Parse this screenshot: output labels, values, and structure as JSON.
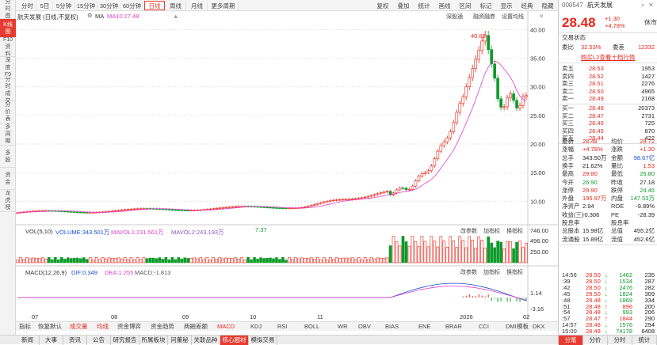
{
  "sidebar": {
    "tabs": [
      {
        "label": "分时图",
        "active": false
      },
      {
        "label": "K线图",
        "active": true
      },
      {
        "label": "F10资料",
        "active": false
      },
      {
        "label": "深度F9",
        "active": false
      },
      {
        "label": "分时成交",
        "active": false
      },
      {
        "label": "分价表",
        "active": false
      },
      {
        "label": "多周期",
        "active": false
      },
      {
        "label": "多股",
        "active": false
      },
      {
        "label": "资金",
        "active": false
      },
      {
        "label": "龙虎榜",
        "active": false
      }
    ]
  },
  "toolbar": {
    "period_tabs": [
      "分时",
      "5日",
      "5分钟",
      "15分钟",
      "30分钟",
      "60分钟",
      "日线",
      "周线",
      "月线",
      "更多周期"
    ],
    "active_period": "日线",
    "right_buttons": [
      "复权",
      "叠加",
      "统计",
      "画线",
      "区间",
      "标记",
      "显示",
      "经典",
      "隐藏"
    ]
  },
  "chart": {
    "stock_title": "航天发展",
    "adjust_note": "(日线,不复权)",
    "ma_label": "MA",
    "ma_value": "MA10:27.48",
    "panel_buttons": [
      "深股通",
      "融资融券",
      "设置均线"
    ],
    "y_ticks": [
      "40.00",
      "35.00",
      "30.00",
      "25.00",
      "20.00",
      "15.00",
      "10.00"
    ],
    "high_annotation": "40.65",
    "low_annotation": "7.37",
    "vol_label": "VOL(5,10)",
    "vol_value": "VOLUME:343.501万",
    "vol_ma5": "MAVOL1:231.561万",
    "vol_ma10": "MAVOL2:243.193万",
    "vol_ticks": [
      "746.00",
      "496.00",
      "250.00"
    ],
    "subpanel_buttons": [
      "改参数",
      "加指标",
      "换指标"
    ],
    "macd_label": "MACD(12,26,9)",
    "macd_dif": "DIF:0.349",
    "macd_dea": "DEA:1.255",
    "macd_val": "MACD:-1.813",
    "macd_ticks": [
      "1.14",
      "-3.16"
    ],
    "x_labels": [
      "07",
      "08",
      "09",
      "10",
      "11",
      "2026",
      "02"
    ]
  },
  "indicator_bar": {
    "items": [
      "指标",
      "恢复默认",
      "成交量",
      "均线",
      "资金博弈",
      "资金趋势",
      "两融差额",
      "MACD",
      "KDJ",
      "RSI",
      "BOLL",
      "WR",
      "OBV",
      "BIAS",
      "ENE",
      "BRAR",
      "CCI",
      "DMI",
      "DKX",
      "CR",
      "PSY",
      "KD",
      "更多"
    ],
    "right": "模板"
  },
  "bottom_tabs": {
    "items": [
      "新闻",
      "大事",
      "资讯",
      "公告",
      "研究报告",
      "所属板块",
      "问董秘",
      "关联品种",
      "核心题材",
      "模拟交易"
    ],
    "active": "核心题材"
  },
  "quote": {
    "code": "000547",
    "name": "航天发展",
    "list_label": "休市",
    "price": "28.48",
    "change": "+1.30",
    "change_pct": "+4.78%",
    "status_label": "交易状态",
    "weibi_label": "委比",
    "weibi": "32.53%",
    "weicha_label": "委差",
    "weicha": "12332",
    "l2_link": "购买L2查看十档行情",
    "asks": [
      {
        "label": "卖五",
        "price": "28.53",
        "vol": "1953"
      },
      {
        "label": "卖四",
        "price": "28.52",
        "vol": "1427"
      },
      {
        "label": "卖三",
        "price": "28.51",
        "vol": "2276"
      },
      {
        "label": "卖二",
        "price": "28.50",
        "vol": "4965"
      },
      {
        "label": "卖一",
        "price": "28.49",
        "vol": "2168"
      }
    ],
    "bids": [
      {
        "label": "买一",
        "price": "28.48",
        "vol": "20373"
      },
      {
        "label": "买二",
        "price": "28.47",
        "vol": "2731"
      },
      {
        "label": "买三",
        "price": "28.46",
        "vol": "725"
      },
      {
        "label": "买四",
        "price": "28.45",
        "vol": "870"
      },
      {
        "label": "买五",
        "price": "28.44",
        "vol": "422"
      }
    ],
    "stats": [
      {
        "k1": "最新",
        "v1": "28.48",
        "c1": "red",
        "k2": "均价",
        "v2": "28.72",
        "c2": "red"
      },
      {
        "k1": "涨幅",
        "v1": "+4.78%",
        "c1": "red",
        "k2": "涨跌",
        "v2": "+1.30",
        "c2": "red"
      },
      {
        "k1": "总手",
        "v1": "343.50万",
        "c1": "dk",
        "k2": "金额",
        "v2": "98.67亿",
        "c2": "blue"
      },
      {
        "k1": "换手",
        "v1": "21.62%",
        "c1": "dk",
        "k2": "量比",
        "v2": "1.53",
        "c2": "red"
      },
      {
        "k1": "最高",
        "v1": "29.80",
        "c1": "red",
        "k2": "最低",
        "v2": "26.80",
        "c2": "green"
      },
      {
        "k1": "今开",
        "v1": "26.90",
        "c1": "green",
        "k2": "昨收",
        "v2": "27.18",
        "c2": "dk"
      },
      {
        "k1": "涨停",
        "v1": "29.90",
        "c1": "red",
        "k2": "跌停",
        "v2": "24.46",
        "c2": "green"
      },
      {
        "k1": "外盘",
        "v1": "195.97万",
        "c1": "red",
        "k2": "内盘",
        "v2": "147.53万",
        "c2": "green"
      },
      {
        "k1": "净资产",
        "v1": "2.94",
        "c1": "dk",
        "k2": "ROE",
        "v2": "-9.89%",
        "c2": "dk"
      },
      {
        "k1": "收益(三)",
        "v1": "-0.306",
        "c1": "dk",
        "k2": "PE",
        "v2": "-28.39",
        "c2": "dk"
      },
      {
        "k1": "股息率",
        "v1": "",
        "c1": "dk",
        "k2": "股息率",
        "v2": "",
        "c2": "dk"
      },
      {
        "k1": "总股本",
        "v1": "15.98亿",
        "c1": "dk",
        "k2": "总值",
        "v2": "455.2亿",
        "c2": "dk"
      },
      {
        "k1": "流通股",
        "v1": "15.89亿",
        "c1": "dk",
        "k2": "流值",
        "v2": "452.6亿",
        "c2": "dk"
      }
    ],
    "ticks": [
      {
        "t": "14:56",
        "p": "28.50",
        "v": "1462",
        "n": "235"
      },
      {
        "t": ":39",
        "p": "28.50",
        "v": "1534",
        "n": "287"
      },
      {
        "t": ":42",
        "p": "28.50",
        "v": "2476",
        "n": "282"
      },
      {
        "t": ":45",
        "p": "28.50",
        "v": "1824",
        "n": "309"
      },
      {
        "t": ":48",
        "p": "28.48",
        "v": "1869",
        "n": "334"
      },
      {
        "t": ":51",
        "p": "28.48",
        "v": "896",
        "n": "200"
      },
      {
        "t": ":54",
        "p": "28.48",
        "v": "993",
        "n": "206"
      },
      {
        "t": ":57",
        "p": "28.47",
        "v": "1844",
        "n": "290"
      },
      {
        "t": "14:57",
        "p": "28.48",
        "v": "1576",
        "n": "294"
      },
      {
        "t": "15:00",
        "p": "28.48",
        "v": "74178",
        "n": "6408"
      }
    ],
    "tick_dirs": [
      "down",
      "down",
      "down",
      "down",
      "down",
      "up",
      "down",
      "up",
      "down",
      "down"
    ],
    "bottom_tabs": [
      "分笔",
      "分价",
      "分时",
      "统计"
    ]
  },
  "colors": {
    "up": "#e8261a",
    "down": "#0c9a28",
    "ma": "#e040c8",
    "accent": "#e83a2e"
  },
  "chart_data": {
    "type": "line",
    "title": "航天发展",
    "series": [
      {
        "name": "close",
        "x": [
          "07",
          "08",
          "09",
          "10",
          "11",
          "2026",
          "02"
        ],
        "values": [
          7.8,
          8.6,
          9.3,
          10.5,
          11.5,
          23,
          28.48
        ]
      },
      {
        "name": "MA10",
        "x": [
          "07",
          "08",
          "09",
          "10",
          "11",
          "2026",
          "02"
        ],
        "values": [
          7.9,
          8.5,
          9.2,
          10.3,
          11.2,
          21,
          27.48
        ]
      }
    ],
    "ylim": [
      7,
      41
    ],
    "annotations": {
      "high": 40.65,
      "low": 7.37
    },
    "xlabel": "",
    "ylabel": ""
  }
}
